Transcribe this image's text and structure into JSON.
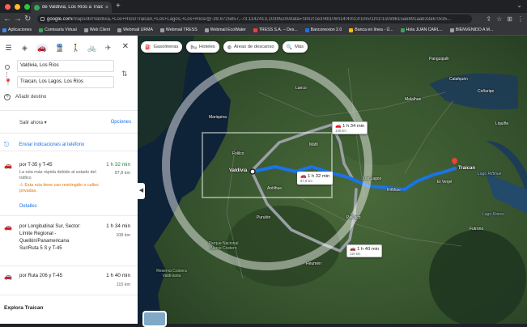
{
  "browser": {
    "tab_title": "de Valdivia, Los Ríos a Traica...",
    "tab_close": "×",
    "new_tab": "+",
    "tab_menu": "⌄",
    "url_host": "google.com",
    "url_path": "/maps/dir/Valdivia,+Los+Ríos/Traican,+Los+Lagos,+Los+Ríos/@-39.8725857,-73.1142413,103952m/data=!3m2!1e3!4b1!4m14!4m13!1m5!1m1!1s0x9615ae891aab33a6:0x35...",
    "back": "←",
    "forward": "→",
    "reload": "↻",
    "addr_icons": [
      "⇪",
      "☆",
      "⊞",
      "⋮"
    ],
    "bookmarks": [
      {
        "label": "Aplicaciones",
        "color": "#4285f4"
      },
      {
        "label": "Comisaría Virtual",
        "color": "#34a853"
      },
      {
        "label": "Web Client",
        "color": "#9aa0a6"
      },
      {
        "label": "Webmail URMA",
        "color": "#9aa0a6"
      },
      {
        "label": "Webmail TRESS",
        "color": "#9aa0a6"
      },
      {
        "label": "Webmail EcoWater",
        "color": "#9aa0a6"
      },
      {
        "label": "TRESS S.A. – Des...",
        "color": "#ea4335"
      },
      {
        "label": "Banconexion 2.0",
        "color": "#1a73e8"
      },
      {
        "label": "Banca en línea - Ú...",
        "color": "#fbbc04"
      },
      {
        "label": "Hola JUAN CARL...",
        "color": "#34a853"
      },
      {
        "label": "BIENVENIDO A M...",
        "color": "#9aa0a6"
      }
    ]
  },
  "directions": {
    "modes": [
      {
        "name": "best-mode-icon",
        "glyph": "◈"
      },
      {
        "name": "car-mode-icon",
        "glyph": "🚗"
      },
      {
        "name": "transit-mode-icon",
        "glyph": "🚆"
      },
      {
        "name": "walk-mode-icon",
        "glyph": "🚶"
      },
      {
        "name": "bike-mode-icon",
        "glyph": "🚲"
      },
      {
        "name": "flight-mode-icon",
        "glyph": "✈"
      }
    ],
    "menu_icon": "☰",
    "close_icon": "✕",
    "origin": "Valdivia, Los Ríos",
    "destination": "Traican, Los Lagos, Los Ríos",
    "add_destination": "Añadir destino",
    "depart": "Salir ahora",
    "options": "Opciones",
    "send_to_phone": "Enviar indicaciones al teléfono",
    "routes": [
      {
        "name": "por T-35 y T-45",
        "time": "1 h 32 min",
        "distance": "87,8 km",
        "desc": "La ruta más rápida debido al estado del tráfico",
        "warning": "⚠ Esta ruta tiene uso restringido o calles privadas.",
        "details": "Detalles"
      },
      {
        "name": "por Longitudinal Sur, Sector: Límite Regional - Quellón/Panamericana Sur/Ruta 5 S y T-45",
        "time": "1 h 34 min",
        "distance": "108 km"
      },
      {
        "name": "por Ruta 206 y T-45",
        "time": "1 h 40 min",
        "distance": "115 km"
      }
    ],
    "explore": "Explora Traican",
    "collapse": "◀"
  },
  "map": {
    "chips": [
      {
        "name": "gas-stations-chip",
        "icon": "⛽",
        "label": "Gasolineras"
      },
      {
        "name": "hotels-chip",
        "icon": "🛏",
        "label": "Hoteles"
      },
      {
        "name": "rest-areas-chip",
        "icon": "◍",
        "label": "Áreas de descanso"
      },
      {
        "name": "more-chip",
        "icon": "🔍",
        "label": "Más"
      }
    ],
    "time_boxes": [
      {
        "time": "1 h 34 min",
        "dist": "108 km"
      },
      {
        "time": "1 h 32 min",
        "dist": "87,8 km"
      },
      {
        "time": "1 h 40 min",
        "dist": "115 km"
      }
    ],
    "places": [
      "Valdivia",
      "Traican",
      "Panguipulli",
      "Máfil",
      "Los Lagos",
      "Lanco",
      "Futrono",
      "Paillaco",
      "Reumén",
      "Mariquina",
      "Folilco",
      "Antilhue",
      "Purulón",
      "Coñaripe",
      "Liquiñe",
      "Riñihue",
      "El Verjel",
      "Parque Nacional Alerce Costero",
      "Reserva Costera Valdiviana",
      "Lago Riñihue",
      "Lago Ranco",
      "Malalhue",
      "Calafquén"
    ]
  }
}
